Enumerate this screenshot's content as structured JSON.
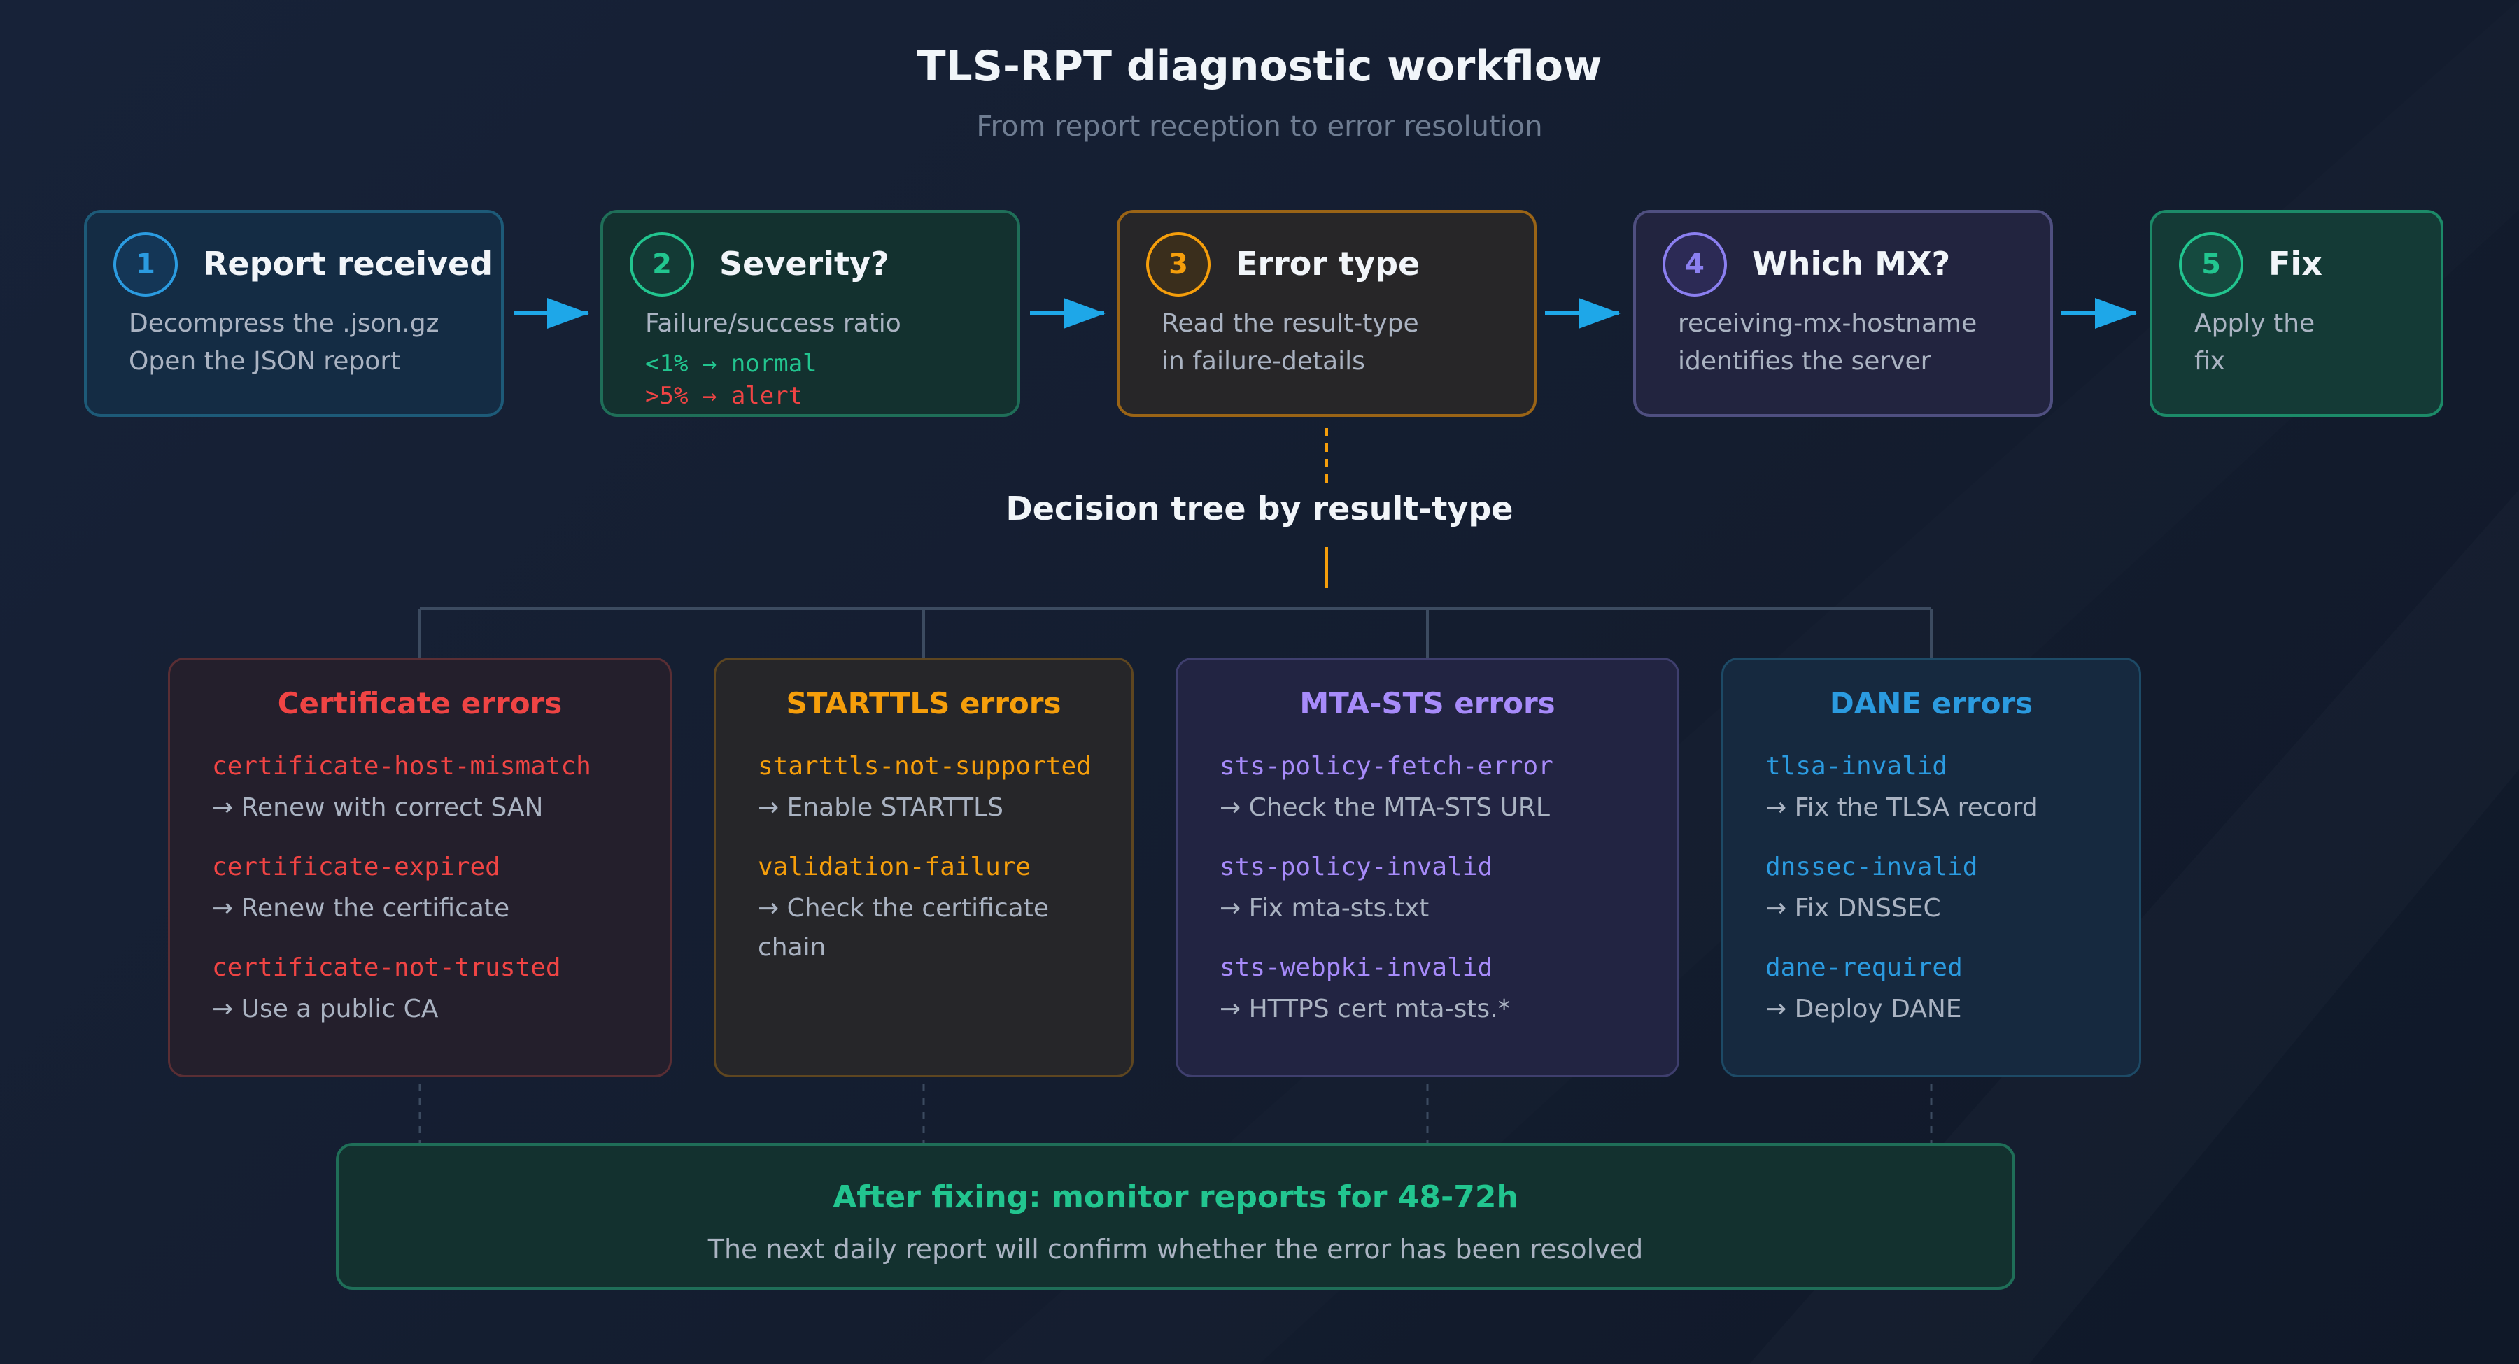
{
  "title": "TLS-RPT diagnostic workflow",
  "subtitle": "From report reception to error resolution",
  "steps": [
    {
      "num": "1",
      "title": "Report received",
      "line1": "Decompress the .json.gz",
      "line2": "Open the JSON report",
      "color": "#2b9be0"
    },
    {
      "num": "2",
      "title": "Severity?",
      "line1": "Failure/success ratio",
      "mono1": "<1% → normal",
      "mono2": ">5% → alert",
      "color": "#22c58f"
    },
    {
      "num": "3",
      "title": "Error type",
      "line1": "Read the result-type",
      "line2": "in failure-details",
      "color": "#f59e0b"
    },
    {
      "num": "4",
      "title": "Which MX?",
      "line1": "receiving-mx-hostname",
      "line2": "identifies the server",
      "color": "#8b7ff0"
    },
    {
      "num": "5",
      "title": "Fix",
      "line1": "Apply the",
      "line2": "fix",
      "color": "#22c58f"
    }
  ],
  "tree_label": "Decision tree by result-type",
  "categories": [
    {
      "title": "Certificate errors",
      "color": "#ef4444",
      "items": [
        {
          "code": "certificate-host-mismatch",
          "action": "→ Renew with correct SAN"
        },
        {
          "code": "certificate-expired",
          "action": "→ Renew the certificate"
        },
        {
          "code": "certificate-not-trusted",
          "action": "→ Use a public CA"
        }
      ]
    },
    {
      "title": "STARTTLS errors",
      "color": "#f59e0b",
      "items": [
        {
          "code": "starttls-not-supported",
          "action": "→ Enable STARTTLS"
        },
        {
          "code": "validation-failure",
          "action": "→ Check the certificate chain"
        }
      ]
    },
    {
      "title": "MTA-STS errors",
      "color": "#a78bfa",
      "items": [
        {
          "code": "sts-policy-fetch-error",
          "action": "→ Check the MTA-STS URL"
        },
        {
          "code": "sts-policy-invalid",
          "action": "→ Fix mta-sts.txt"
        },
        {
          "code": "sts-webpki-invalid",
          "action": "→ HTTPS cert mta-sts.*"
        }
      ]
    },
    {
      "title": "DANE errors",
      "color": "#2b9be0",
      "items": [
        {
          "code": "tlsa-invalid",
          "action": "→ Fix the TLSA record"
        },
        {
          "code": "dnssec-invalid",
          "action": "→ Fix DNSSEC"
        },
        {
          "code": "dane-required",
          "action": "→ Deploy DANE"
        }
      ]
    }
  ],
  "footer": {
    "title": "After fixing: monitor reports for 48-72h",
    "subtitle": "The next daily report will confirm whether the error has been resolved"
  }
}
